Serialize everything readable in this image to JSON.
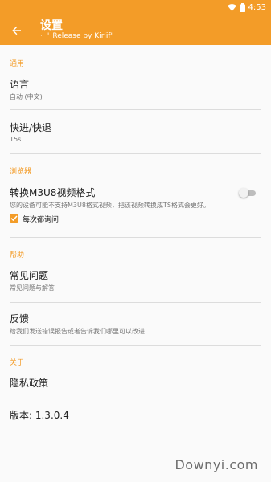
{
  "status_bar": {
    "time": "4:53",
    "wifi_icon": "wifi-icon",
    "battery_icon": "battery-icon"
  },
  "toolbar": {
    "back_icon": "arrow-back-icon",
    "title": "设置",
    "subtitle": "Release by Kirlif'",
    "subtitle_quote_open": "'",
    "subtitle_dot": "·"
  },
  "sections": {
    "general": {
      "header": "通用",
      "language": {
        "title": "语言",
        "summary": "自动 (中文)"
      },
      "seek": {
        "title": "快进/快退",
        "summary": "15s"
      }
    },
    "browser": {
      "header": "浏览器",
      "convert": {
        "title": "转换M3U8视频格式",
        "summary": "您的设备可能不支持M3U8格式视频，把该视频转换成TS格式会更好。",
        "enabled": false
      },
      "ask_every_time": {
        "label": "每次都询问",
        "checked": true
      }
    },
    "help": {
      "header": "帮助",
      "faq": {
        "title": "常见问题",
        "summary": "常见问题与解答"
      },
      "feedback": {
        "title": "反馈",
        "summary": "给我们发送错误报告或者告诉我们哪里可以改进"
      }
    },
    "about": {
      "header": "关于",
      "privacy": {
        "title": "隐私政策"
      },
      "version": {
        "title": "版本: 1.3.0.4"
      }
    }
  },
  "watermark": "Downyi.com",
  "colors": {
    "accent": "#f39c28",
    "divider": "#dcdcdc",
    "summary": "#757575"
  }
}
